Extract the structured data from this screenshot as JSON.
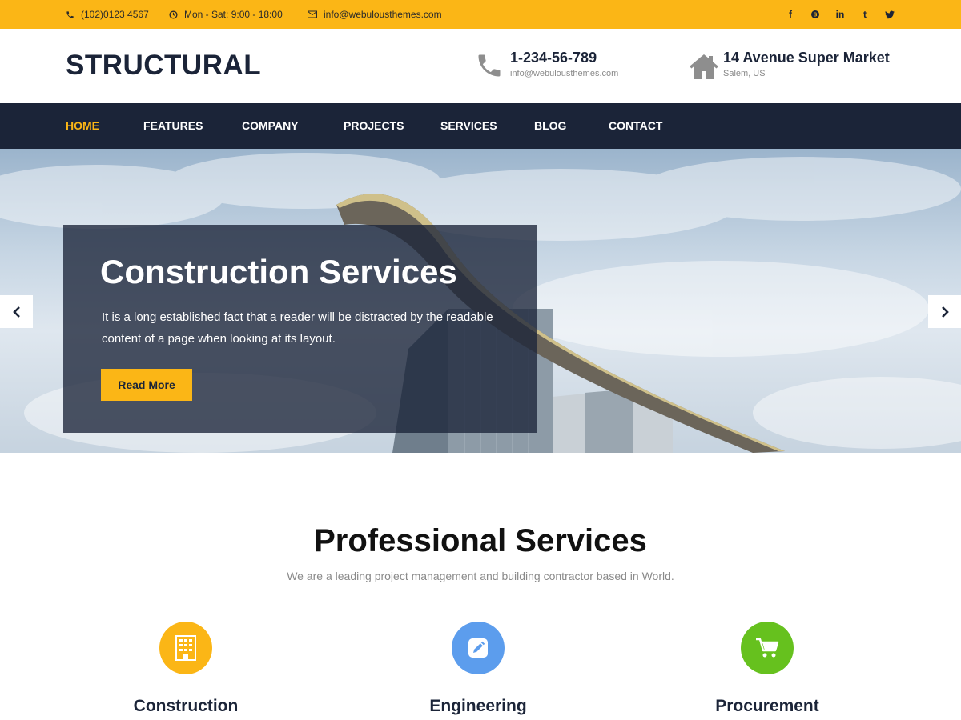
{
  "topbar": {
    "phone": "(102)0123 4567",
    "hours": "Mon - Sat: 9:00 - 18:00",
    "email": "info@webulousthemes.com",
    "social": [
      {
        "name": "facebook-icon",
        "glyph": "f"
      },
      {
        "name": "skype-icon",
        "glyph": "S"
      },
      {
        "name": "linkedin-icon",
        "glyph": "in"
      },
      {
        "name": "tumblr-icon",
        "glyph": "t"
      },
      {
        "name": "twitter-icon",
        "glyph": "🐦"
      }
    ]
  },
  "header": {
    "logo": "STRUCTURAL",
    "contact": {
      "phone": "1-234-56-789",
      "email": "info@webulousthemes.com"
    },
    "address": {
      "line1": "14 Avenue Super Market",
      "line2": "Salem, US"
    }
  },
  "nav": {
    "items": [
      "HOME",
      "FEATURES",
      "COMPANY",
      "PROJECTS",
      "SERVICES",
      "BLOG",
      "CONTACT"
    ],
    "active": "HOME"
  },
  "hero": {
    "title": "Construction Services",
    "text": "It is a long established fact that a reader will be distracted by the readable content of a page when looking at its layout.",
    "button": "Read More"
  },
  "services": {
    "title": "Professional Services",
    "subtitle": "We are a leading project management and building contractor based in World.",
    "items": [
      {
        "name": "Construction",
        "icon": "building-icon",
        "color": "#fbb616"
      },
      {
        "name": "Engineering",
        "icon": "pencil-icon",
        "color": "#5c9ded"
      },
      {
        "name": "Procurement",
        "icon": "cart-icon",
        "color": "#66c11e"
      }
    ]
  },
  "colors": {
    "accent": "#fbb616",
    "navy": "#1b2438"
  }
}
